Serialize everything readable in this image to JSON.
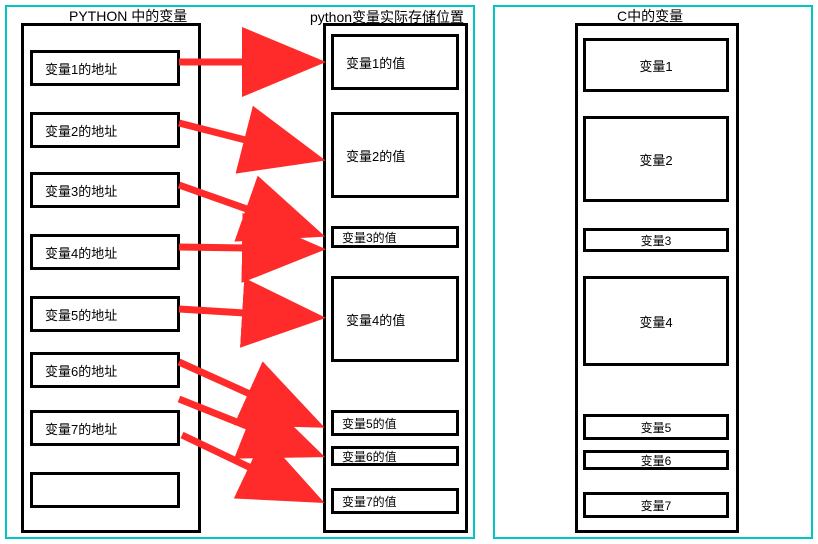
{
  "headings": {
    "python_vars": "PYTHON 中的变量",
    "python_storage": "python变量实际存储位置",
    "c_vars": "C中的变量"
  },
  "python_addresses": {
    "a1": "变量1的地址",
    "a2": "变量2的地址",
    "a3": "变量3的地址",
    "a4": "变量4的地址",
    "a5": "变量5的地址",
    "a6": "变量6的地址",
    "a7": "变量7的地址"
  },
  "python_values": {
    "v1": "变量1的值",
    "v2": "变量2的值",
    "v3": "变量3的值",
    "v4": "变量4的值",
    "v5": "变量5的值",
    "v6": "变量6的值",
    "v7": "变量7的值"
  },
  "c_vars": {
    "c1": "变量1",
    "c2": "变量2",
    "c3": "变量3",
    "c4": "变量4",
    "c5": "变量5",
    "c6": "变量6",
    "c7": "变量7"
  },
  "colors": {
    "panel_border": "#00c5c5",
    "arrow": "#ff2a2a",
    "box_border": "#000000"
  }
}
